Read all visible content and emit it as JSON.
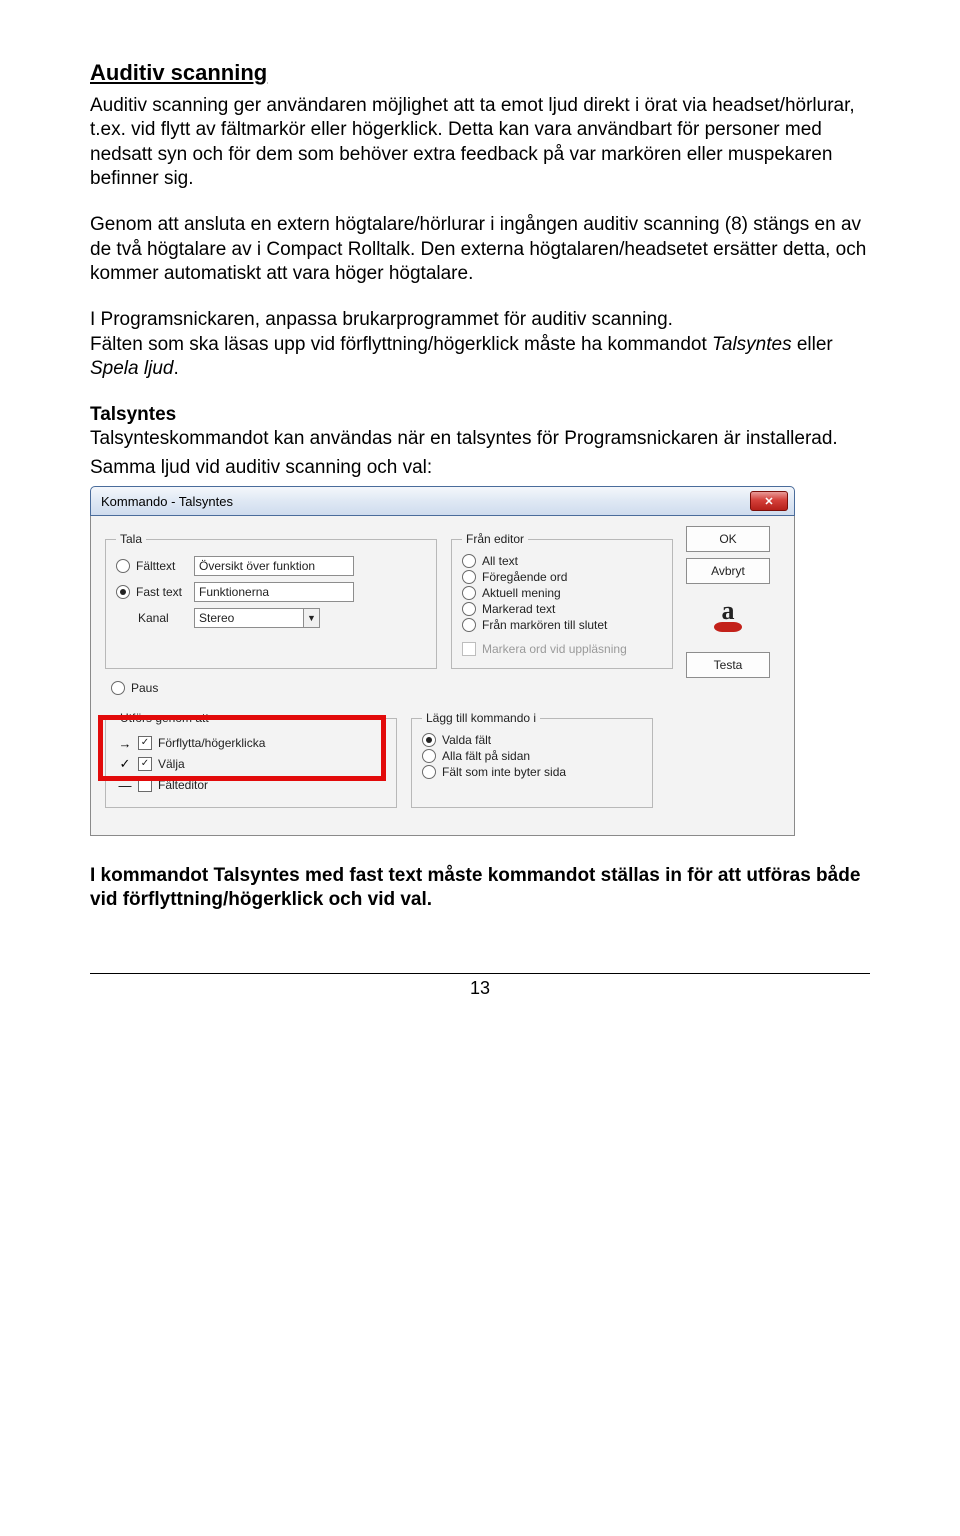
{
  "heading": "Auditiv scanning",
  "p1": "Auditiv scanning ger användaren möjlighet att ta emot ljud direkt i örat via headset/hörlurar, t.ex. vid flytt av fältmarkör eller högerklick. Detta kan vara användbart för personer med nedsatt syn och för dem som behöver extra feedback på var markören eller muspekaren befinner sig.",
  "p2": "Genom att ansluta en extern högtalare/hörlurar i ingången auditiv scanning (8) stängs en av de två högtalare av i Compact Rolltalk. Den externa högtalaren/headsetet ersätter detta, och kommer automatiskt att vara höger högtalare.",
  "p3a": "I Programsnickaren, anpassa brukarprogrammet för auditiv scanning.",
  "p3b_pre": "Fälten som ska läsas upp vid förflyttning/högerklick måste ha kommandot ",
  "p3b_i1": "Talsyntes",
  "p3b_mid": " eller ",
  "p3b_i2": "Spela ljud",
  "p3b_end": ".",
  "h2": "Talsyntes",
  "p4": "Talsynteskommandot kan användas när en talsyntes för Programsnickaren är installerad.",
  "p5": "Samma ljud vid auditiv scanning och val:",
  "dialog": {
    "title": "Kommando - Talsyntes",
    "close": "✕",
    "ok": "OK",
    "cancel": "Avbryt",
    "testa": "Testa",
    "tala": {
      "legend": "Tala",
      "falttext": "Fälttext",
      "fasttext": "Fast text",
      "kanal": "Kanal",
      "val_oversikt": "Översikt över funktion",
      "val_funktionerna": "Funktionerna",
      "val_stereo": "Stereo"
    },
    "editor": {
      "legend": "Från editor",
      "o1": "All text",
      "o2": "Föregående ord",
      "o3": "Aktuell mening",
      "o4": "Markerad text",
      "o5": "Från markören till slutet",
      "chk": "Markera ord vid uppläsning"
    },
    "paus": "Paus",
    "utfors": {
      "legend": "Utförs genom att",
      "o1": "Förflytta/högerklicka",
      "o2": "Välja",
      "o3": "Fälteditor"
    },
    "lagg": {
      "legend": "Lägg till kommando i",
      "o1": "Valda fält",
      "o2": "Alla fält på sidan",
      "o3": "Fält som inte byter sida"
    }
  },
  "p6": "I kommandot Talsyntes med fast text måste kommandot ställas in för att utföras både vid förflyttning/högerklick och vid val.",
  "pagenum": "13"
}
